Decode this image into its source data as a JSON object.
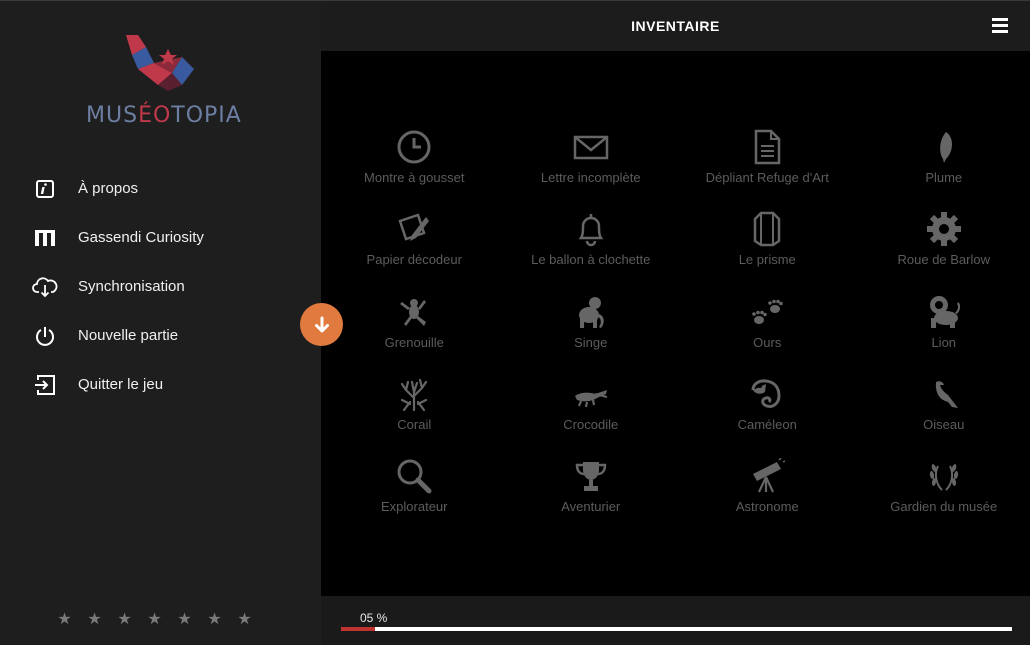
{
  "app": {
    "brand": {
      "name_part1": "MUS",
      "name_accent": "ÉO",
      "name_part2": "TOPIA"
    },
    "colors": {
      "accent": "#e07a3e",
      "brand_red": "#c0394b",
      "brand_blue": "#6d7ea3",
      "progress": "#c0342f"
    }
  },
  "sidebar": {
    "items": [
      {
        "label": "À propos",
        "icon": "info-icon"
      },
      {
        "label": "Gassendi Curiosity",
        "icon": "museum-logo-icon"
      },
      {
        "label": "Synchronisation",
        "icon": "cloud-download-icon"
      },
      {
        "label": "Nouvelle partie",
        "icon": "power-icon"
      },
      {
        "label": "Quitter le jeu",
        "icon": "exit-icon"
      }
    ],
    "stars_total": 7
  },
  "header": {
    "title": "INVENTAIRE"
  },
  "inventory": {
    "items": [
      {
        "label": "Montre à gousset",
        "icon": "clock-icon"
      },
      {
        "label": "Lettre incomplète",
        "icon": "envelope-icon"
      },
      {
        "label": "Dépliant Refuge d'Art",
        "icon": "document-icon"
      },
      {
        "label": "Plume",
        "icon": "feather-icon"
      },
      {
        "label": "Papier décodeur",
        "icon": "paper-pen-icon"
      },
      {
        "label": "Le ballon à clochette",
        "icon": "bell-icon"
      },
      {
        "label": "Le prisme",
        "icon": "prism-icon"
      },
      {
        "label": "Roue de Barlow",
        "icon": "gear-icon"
      },
      {
        "label": "Grenouille",
        "icon": "frog-icon"
      },
      {
        "label": "Singe",
        "icon": "monkey-icon"
      },
      {
        "label": "Ours",
        "icon": "paw-prints-icon"
      },
      {
        "label": "Lion",
        "icon": "lion-icon"
      },
      {
        "label": "Corail",
        "icon": "coral-icon"
      },
      {
        "label": "Crocodile",
        "icon": "crocodile-icon"
      },
      {
        "label": "Caméleon",
        "icon": "chameleon-icon"
      },
      {
        "label": "Oiseau",
        "icon": "bird-icon"
      },
      {
        "label": "Explorateur",
        "icon": "magnifier-icon"
      },
      {
        "label": "Aventurier",
        "icon": "trophy-icon"
      },
      {
        "label": "Astronome",
        "icon": "telescope-icon"
      },
      {
        "label": "Gardien du musée",
        "icon": "laurel-icon"
      }
    ]
  },
  "progress": {
    "text": "05 %",
    "value_percent": 5
  }
}
